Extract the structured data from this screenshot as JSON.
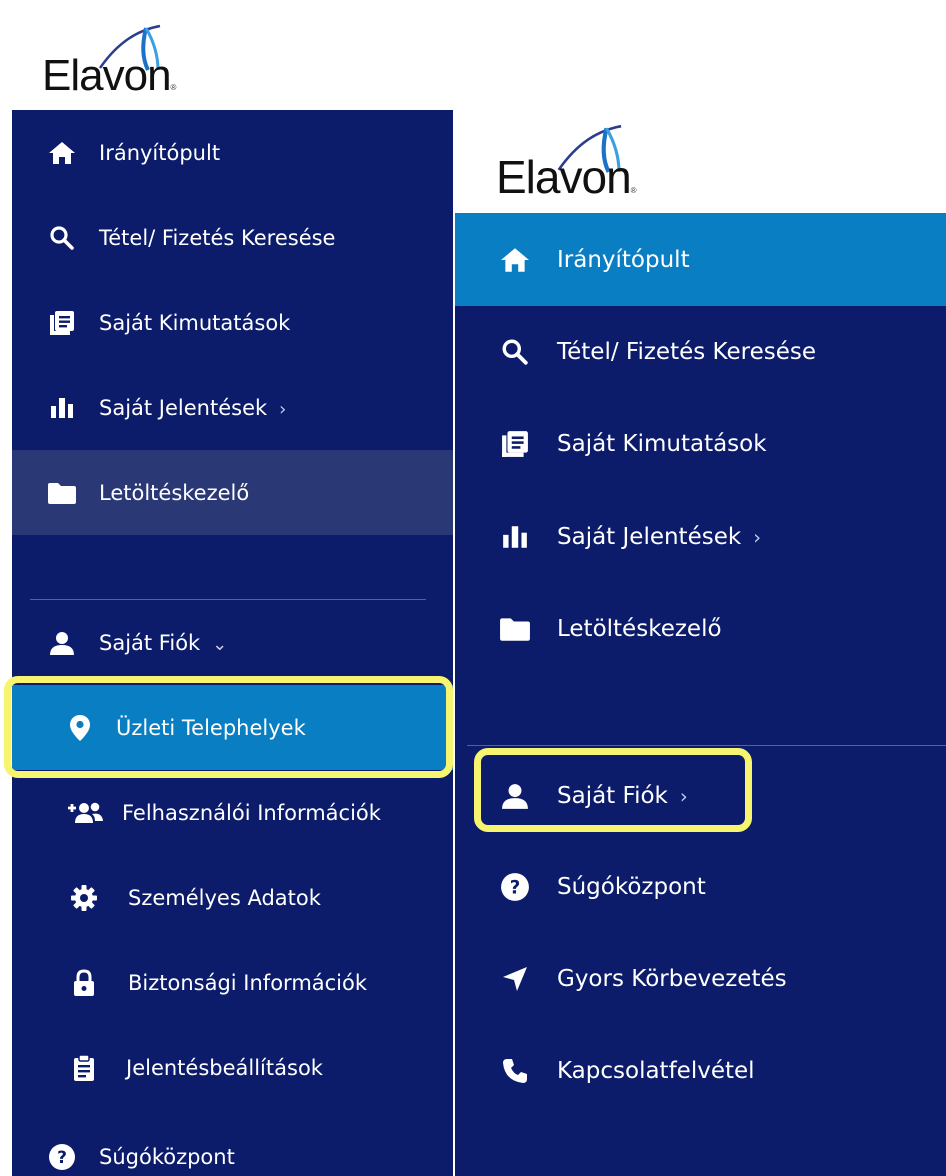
{
  "brand": {
    "name": "Elavon",
    "reg_mark": "®"
  },
  "colors": {
    "sidebar": "#0c1c6a",
    "active": "#0a7ec2",
    "hover": "#2a3876",
    "highlight": "#f7f56f",
    "text": "#ffffff"
  },
  "left_menu": {
    "items": [
      {
        "label": "Irányítópult",
        "icon": "home-icon"
      },
      {
        "label": "Tétel/ Fizetés Keresése",
        "icon": "search-icon"
      },
      {
        "label": "Saját Kimutatások",
        "icon": "statements-icon"
      },
      {
        "label": "Saját Jelentések",
        "icon": "bar-chart-icon",
        "chevron": "›"
      },
      {
        "label": "Letöltéskezelő",
        "icon": "folder-icon"
      }
    ],
    "account": {
      "label": "Saját Fiók",
      "icon": "user-icon",
      "chevron": "⌄"
    },
    "sub_items": [
      {
        "label": "Üzleti Telephelyek",
        "icon": "location-pin-icon"
      },
      {
        "label": "Felhasználói Információk",
        "icon": "add-users-icon"
      },
      {
        "label": "Személyes Adatok",
        "icon": "gear-icon"
      },
      {
        "label": "Biztonsági Információk",
        "icon": "lock-icon"
      },
      {
        "label": "Jelentésbeállítások",
        "icon": "clipboard-icon"
      }
    ],
    "help": {
      "label": "Súgóközpont",
      "icon": "help-icon"
    }
  },
  "right_menu": {
    "items": [
      {
        "label": "Irányítópult",
        "icon": "home-icon"
      },
      {
        "label": "Tétel/ Fizetés Keresése",
        "icon": "search-icon"
      },
      {
        "label": "Saját Kimutatások",
        "icon": "statements-icon"
      },
      {
        "label": "Saját Jelentések",
        "icon": "bar-chart-icon",
        "chevron": "›"
      },
      {
        "label": "Letöltéskezelő",
        "icon": "folder-icon"
      }
    ],
    "account": {
      "label": "Saját Fiók",
      "icon": "user-icon",
      "chevron": "›"
    },
    "bottom_items": [
      {
        "label": "Súgóközpont",
        "icon": "help-icon"
      },
      {
        "label": "Gyors Körbevezetés",
        "icon": "navigation-arrow-icon"
      },
      {
        "label": "Kapcsolatfelvétel",
        "icon": "phone-icon"
      }
    ]
  }
}
